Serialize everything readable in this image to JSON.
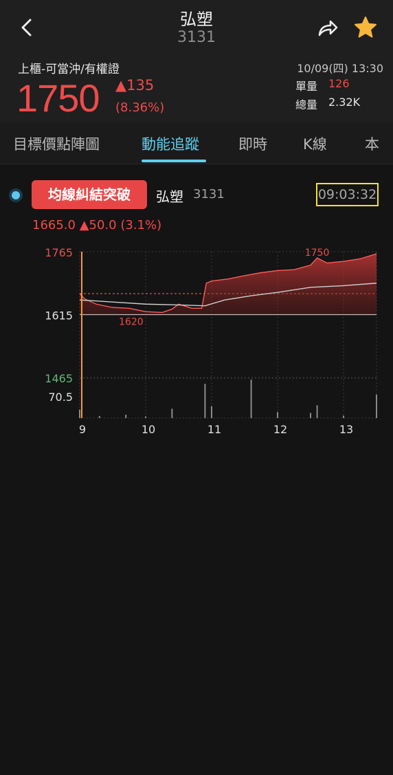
{
  "header": {
    "title": "弘塑",
    "code": "3131",
    "market_tag": "上櫃-可當沖/有權證",
    "price": "1750",
    "change": "▲135",
    "change_pct": "(8.36%)",
    "datetime": "10/09(四) 13:30",
    "unit_volume_label": "單量",
    "unit_volume": "126",
    "total_volume_label": "總量",
    "total_volume": "2.32K"
  },
  "tabs": [
    {
      "label": "目標價點陣圖"
    },
    {
      "label": "動能追蹤",
      "active": true
    },
    {
      "label": "即時"
    },
    {
      "label": "K線"
    },
    {
      "label": "本"
    }
  ],
  "signal": {
    "badge": "均線糾結突破",
    "name": "弘塑",
    "code": "3131",
    "time": "09:03:32",
    "price_line": "1665.0 ▲50.0 (3.1%)"
  },
  "colors": {
    "up": "#ee4b4b",
    "accent": "#5fd0ee",
    "down": "#5fb878",
    "highlight": "#f5e32a"
  },
  "chart_data": {
    "type": "area",
    "y_ticks": [
      "1765",
      "1615",
      "1465"
    ],
    "volume_tick": "70.5",
    "x_ticks": [
      "9",
      "10",
      "11",
      "12",
      "13"
    ],
    "annotations": [
      "1750",
      "1620"
    ],
    "ylim": [
      1465,
      1765
    ],
    "reference_price": 1615,
    "signal_price": 1665,
    "price": {
      "x": [
        9.0,
        9.08,
        9.25,
        9.5,
        9.75,
        10.0,
        10.25,
        10.4,
        10.5,
        10.6,
        10.7,
        10.85,
        10.92,
        11.0,
        11.25,
        11.5,
        11.75,
        12.0,
        12.25,
        12.5,
        12.6,
        12.75,
        13.0,
        13.25,
        13.5
      ],
      "values": [
        1665,
        1652,
        1640,
        1632,
        1630,
        1622,
        1620,
        1628,
        1640,
        1635,
        1630,
        1630,
        1690,
        1695,
        1700,
        1708,
        1715,
        1720,
        1722,
        1733,
        1750,
        1738,
        1742,
        1748,
        1760
      ]
    },
    "average": {
      "x": [
        9.0,
        9.5,
        10.0,
        10.5,
        10.9,
        11.2,
        11.6,
        12.0,
        12.5,
        13.0,
        13.5
      ],
      "values": [
        1650,
        1645,
        1640,
        1638,
        1636,
        1650,
        1660,
        1668,
        1680,
        1684,
        1690
      ]
    },
    "volume": {
      "x": [
        9.0,
        9.3,
        9.7,
        10.0,
        10.4,
        10.9,
        11.0,
        11.6,
        12.0,
        12.5,
        12.6,
        13.0,
        13.5
      ],
      "values": [
        20,
        5,
        8,
        4,
        22,
        80,
        28,
        90,
        14,
        12,
        30,
        6,
        55
      ]
    }
  }
}
